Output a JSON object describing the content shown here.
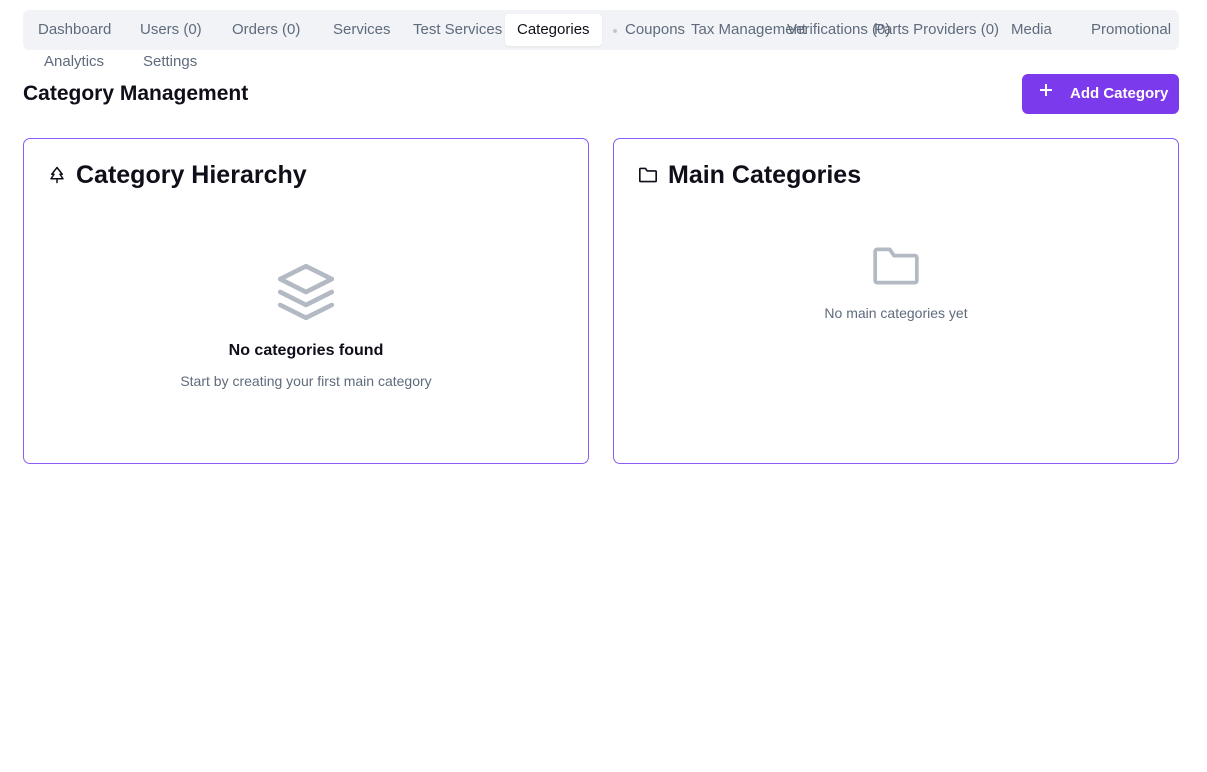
{
  "nav": {
    "tabs": [
      {
        "label": "Dashboard"
      },
      {
        "label": "Users (0)"
      },
      {
        "label": "Orders (0)"
      },
      {
        "label": "Services"
      },
      {
        "label": "Test Services"
      },
      {
        "label": "Categories",
        "active": true
      },
      {
        "label": "Coupons"
      },
      {
        "label": "Tax Management"
      },
      {
        "label": "Verifications (0)"
      },
      {
        "label": "Parts Providers (0)"
      },
      {
        "label": "Media"
      },
      {
        "label": "Promotional"
      },
      {
        "label": "Analytics"
      },
      {
        "label": "Settings"
      }
    ]
  },
  "page": {
    "title": "Category Management",
    "add_button": "Add Category"
  },
  "hierarchy": {
    "title": "Category Hierarchy",
    "icon": "tree-icon",
    "empty_icon": "layers-icon",
    "empty_title": "No categories found",
    "empty_subtitle": "Start by creating your first main category"
  },
  "main_categories": {
    "title": "Main Categories",
    "icon": "folder-icon",
    "empty_icon": "folder-icon",
    "empty_text": "No main categories yet"
  },
  "colors": {
    "accent": "#7c3aed",
    "card_border": "#8b5cf6",
    "muted_text": "#5f6b7c",
    "empty_icon": "#b4bac4"
  }
}
